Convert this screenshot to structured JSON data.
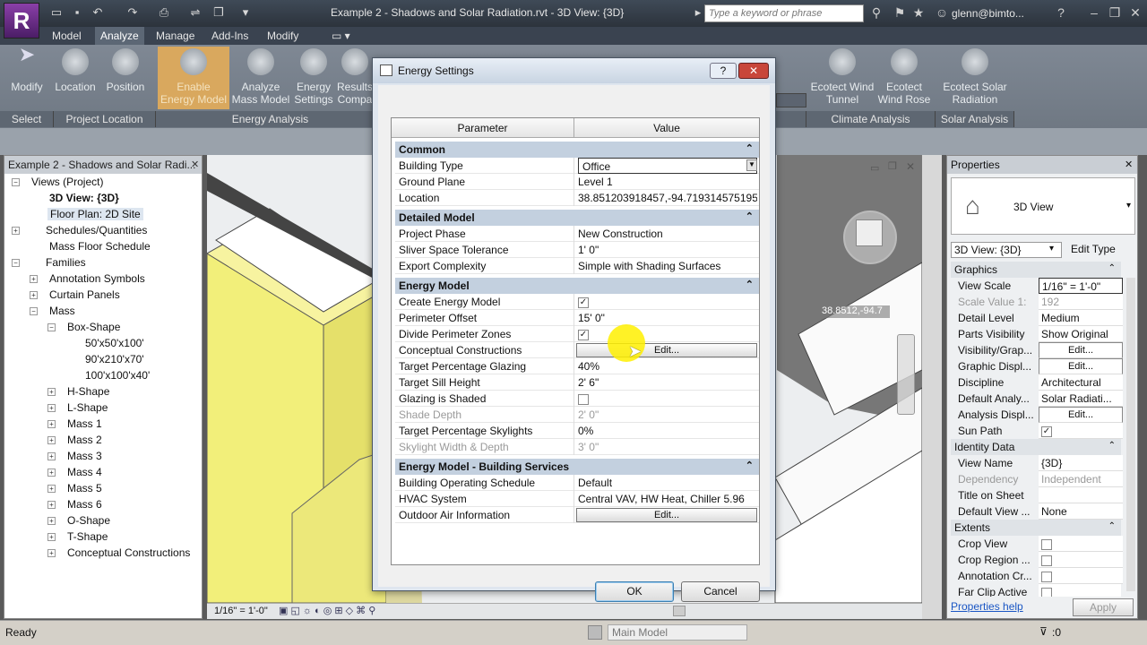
{
  "titlebar": {
    "title": "Example 2 - Shadows and Solar Radiation.rvt - 3D View: {3D}",
    "search_placeholder": "Type a keyword or phrase",
    "user": "glenn@bimto..."
  },
  "menu": {
    "tabs": [
      "Model",
      "Analyze",
      "Manage",
      "Add-Ins",
      "Modify"
    ]
  },
  "ribbon": {
    "buttons": {
      "modify": "Modify",
      "location": "Location",
      "position": "Position",
      "enable_energy": "Enable Energy Model",
      "analyze_mass": "Analyze Mass Model",
      "energy_settings": "Energy Settings",
      "results": "Results Compa",
      "wind_tunnel": "Ecotect Wind Tunnel",
      "wind_rose": "Ecotect Wind Rose",
      "solar_radiation": "Ecotect Solar Radiation"
    },
    "panels": {
      "select": "Select",
      "project_location": "Project Location",
      "energy_analysis": "Energy Analysis",
      "climate_analysis": "Climate Analysis",
      "solar_analysis": "Solar Analysis"
    }
  },
  "project_browser": {
    "title": "Example 2 - Shadows and Solar Radi...",
    "items": {
      "views": "Views (Project)",
      "view3d": "3D View: {3D}",
      "floorplan": "Floor Plan: 2D Site",
      "schedules": "Schedules/Quantities",
      "mass_floor": "Mass Floor Schedule",
      "families": "Families",
      "annotation": "Annotation Symbols",
      "curtain": "Curtain Panels",
      "mass": "Mass",
      "boxshape": "Box-Shape",
      "b1": "50'x50'x100'",
      "b2": "90'x210'x70'",
      "b3": "100'x100'x40'",
      "hshape": "H-Shape",
      "lshape": "L-Shape",
      "m1": "Mass 1",
      "m2": "Mass 2",
      "m3": "Mass 3",
      "m4": "Mass 4",
      "m5": "Mass 5",
      "m6": "Mass 6",
      "oshape": "O-Shape",
      "tshape": "T-Shape",
      "concept": "Conceptual Constructions"
    }
  },
  "viewport": {
    "coord": "38.8512,-94.7",
    "scale": "1/16\" = 1'-0\""
  },
  "dialog": {
    "title": "Energy Settings",
    "col_param": "Parameter",
    "col_value": "Value",
    "sections": {
      "common": "Common",
      "detailed": "Detailed Model",
      "energy": "Energy Model",
      "services": "Energy Model - Building Services"
    },
    "rows": {
      "building_type": {
        "k": "Building Type",
        "v": "Office"
      },
      "ground_plane": {
        "k": "Ground Plane",
        "v": "Level 1"
      },
      "location": {
        "k": "Location",
        "v": "38.851203918457,-94.719314575195"
      },
      "project_phase": {
        "k": "Project Phase",
        "v": "New Construction"
      },
      "sliver": {
        "k": "Sliver Space Tolerance",
        "v": "1'  0\""
      },
      "export": {
        "k": "Export Complexity",
        "v": "Simple with Shading Surfaces"
      },
      "create_energy": {
        "k": "Create Energy Model",
        "v": "✓"
      },
      "perimeter_offset": {
        "k": "Perimeter Offset",
        "v": "15'  0\""
      },
      "divide_perimeter": {
        "k": "Divide Perimeter Zones",
        "v": "✓"
      },
      "conceptual": {
        "k": "Conceptual Constructions",
        "v": "Edit..."
      },
      "glazing": {
        "k": "Target Percentage Glazing",
        "v": "40%"
      },
      "sill": {
        "k": "Target Sill Height",
        "v": "2'  6\""
      },
      "glazing_shaded": {
        "k": "Glazing is Shaded",
        "v": ""
      },
      "shade_depth": {
        "k": "Shade Depth",
        "v": "2'  0\""
      },
      "skylights": {
        "k": "Target Percentage Skylights",
        "v": "0%"
      },
      "skylight_wd": {
        "k": "Skylight Width & Depth",
        "v": "3'  0\""
      },
      "schedule": {
        "k": "Building Operating Schedule",
        "v": "Default"
      },
      "hvac": {
        "k": "HVAC System",
        "v": "Central VAV, HW Heat, Chiller 5.96"
      },
      "outdoor_air": {
        "k": "Outdoor Air Information",
        "v": "Edit..."
      }
    },
    "ok": "OK",
    "cancel": "Cancel"
  },
  "properties": {
    "title": "Properties",
    "type_name": "3D View",
    "selector": "3D View: {3D}",
    "edit_type": "Edit Type",
    "sections": {
      "graphics": "Graphics",
      "identity": "Identity Data",
      "extents": "Extents"
    },
    "rows": {
      "view_scale": {
        "k": "View Scale",
        "v": "1/16\" = 1'-0\""
      },
      "scale_value": {
        "k": "Scale Value  1:",
        "v": "192"
      },
      "detail": {
        "k": "Detail Level",
        "v": "Medium"
      },
      "parts": {
        "k": "Parts Visibility",
        "v": "Show Original"
      },
      "visgraph": {
        "k": "Visibility/Grap...",
        "v": "Edit..."
      },
      "graphic": {
        "k": "Graphic Displ...",
        "v": "Edit..."
      },
      "discipline": {
        "k": "Discipline",
        "v": "Architectural"
      },
      "default_analysis": {
        "k": "Default Analy...",
        "v": "Solar Radiati..."
      },
      "analysis_disp": {
        "k": "Analysis Displ...",
        "v": "Edit..."
      },
      "sun_path": {
        "k": "Sun Path",
        "v": "✓"
      },
      "view_name": {
        "k": "View Name",
        "v": "{3D}"
      },
      "dependency": {
        "k": "Dependency",
        "v": "Independent"
      },
      "title_sheet": {
        "k": "Title on Sheet",
        "v": ""
      },
      "default_view": {
        "k": "Default View ...",
        "v": "None"
      },
      "crop_view": {
        "k": "Crop View",
        "v": ""
      },
      "crop_region": {
        "k": "Crop Region ...",
        "v": ""
      },
      "annotation_cr": {
        "k": "Annotation Cr...",
        "v": ""
      },
      "far_clip": {
        "k": "Far Clip Active",
        "v": ""
      }
    },
    "help": "Properties help",
    "apply": "Apply"
  },
  "status": {
    "left": "Ready",
    "model": "Main Model",
    "filter": ":0"
  }
}
